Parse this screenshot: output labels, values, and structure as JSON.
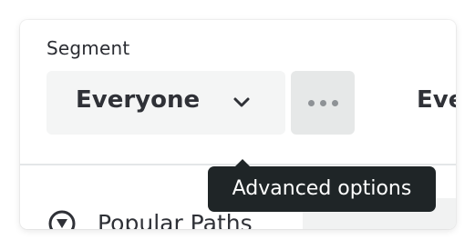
{
  "segment": {
    "label": "Segment",
    "selected_value": "Everyone",
    "dropdown_icon": "chevron-down-icon",
    "more_button_icon": "more-horizontal-icon"
  },
  "adjacent_control": {
    "text": "Eve"
  },
  "nav": {
    "items": [
      {
        "label": "Popular Paths",
        "icon": "paths-icon"
      }
    ]
  },
  "tooltip": {
    "text": "Advanced options"
  },
  "colors": {
    "text_primary": "#2f3137",
    "select_bg": "#f4f5f5",
    "more_button_bg": "#e6e8e8",
    "tooltip_bg": "#1f2527",
    "divider": "#e4e6e8"
  }
}
